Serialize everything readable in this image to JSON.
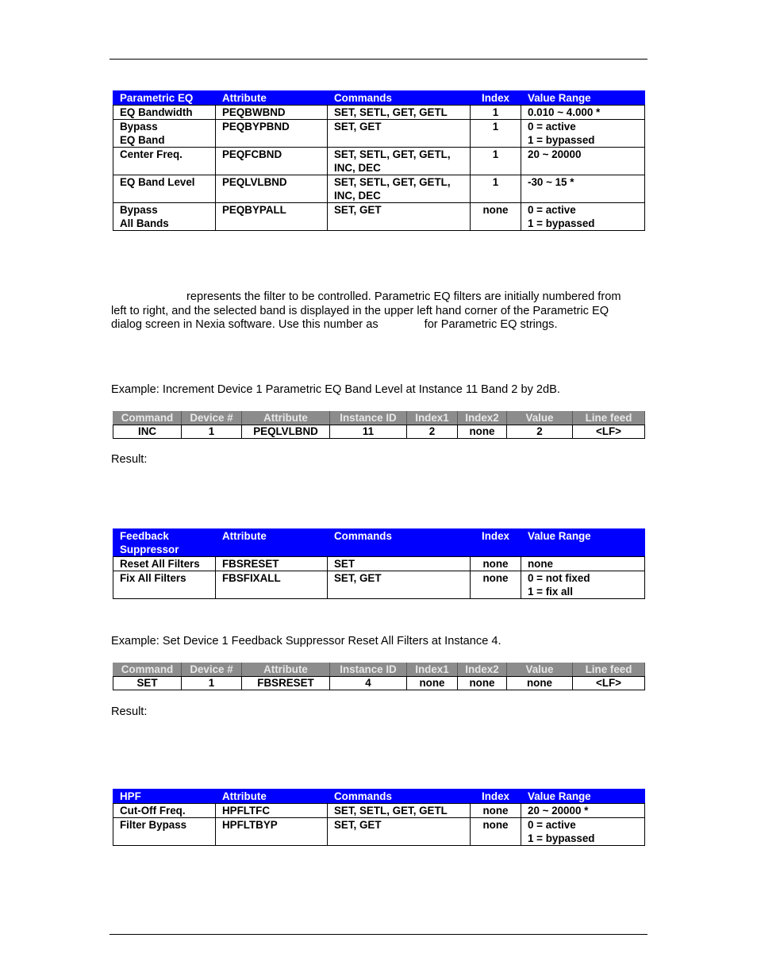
{
  "peq_table": {
    "headers": [
      "Parametric EQ",
      "Attribute",
      "Commands",
      "Index",
      "Value Range"
    ],
    "rows": [
      {
        "name": [
          "EQ Bandwidth"
        ],
        "attribute": "PEQBWBND",
        "commands": [
          "SET, SETL, GET, GETL"
        ],
        "index": "1",
        "range": [
          "0.010 ~ 4.000 *"
        ]
      },
      {
        "name": [
          "Bypass",
          "EQ Band"
        ],
        "attribute": "PEQBYPBND",
        "commands": [
          "SET, GET"
        ],
        "index": "1",
        "range": [
          "0 = active",
          "1 = bypassed"
        ]
      },
      {
        "name": [
          "Center Freq."
        ],
        "attribute": "PEQFCBND",
        "commands": [
          "SET, SETL, GET, GETL,",
          "INC, DEC"
        ],
        "index": "1",
        "range": [
          "20 ~ 20000"
        ]
      },
      {
        "name": [
          "EQ Band Level"
        ],
        "attribute": "PEQLVLBND",
        "commands": [
          "SET, SETL, GET, GETL,",
          "INC, DEC"
        ],
        "index": "1",
        "range": [
          "-30 ~  15 *"
        ]
      },
      {
        "name": [
          "Bypass",
          "All Bands"
        ],
        "attribute": "PEQBYPALL",
        "commands": [
          "SET, GET"
        ],
        "index": "none",
        "range": [
          "0 = active",
          "1 = bypassed"
        ]
      }
    ]
  },
  "peq_paragraph": {
    "part1": "represents the filter to be controlled. Parametric EQ filters are initially numbered from left to right, and the selected band is displayed in the upper left hand corner of the Parametric EQ dialog screen in Nexia software. Use this number as",
    "part2": "for Parametric EQ strings."
  },
  "peq_example": {
    "text": "Example: Increment Device 1 Parametric EQ Band Level at Instance 11 Band 2 by 2dB.",
    "headers": [
      "Command",
      "Device #",
      "Attribute",
      "Instance ID",
      "Index1",
      "Index2",
      "Value",
      "Line feed"
    ],
    "values": [
      "INC",
      "1",
      "PEQLVLBND",
      "11",
      "2",
      "none",
      "2",
      "<LF>"
    ],
    "result_label": "Result:"
  },
  "fbs_table": {
    "headers": [
      "Feedback Suppressor",
      "Attribute",
      "Commands",
      "Index",
      "Value Range"
    ],
    "header_lines": [
      "Feedback",
      "Suppressor"
    ],
    "rows": [
      {
        "name": [
          "Reset All Filters"
        ],
        "attribute": "FBSRESET",
        "commands": [
          "SET"
        ],
        "index": "none",
        "range": [
          "none"
        ]
      },
      {
        "name": [
          "Fix All Filters"
        ],
        "attribute": "FBSFIXALL",
        "commands": [
          "SET, GET"
        ],
        "index": "none",
        "range": [
          "0 = not fixed",
          "1 = fix all"
        ]
      }
    ]
  },
  "fbs_example": {
    "text": "Example: Set Device 1 Feedback Suppressor Reset All Filters at Instance 4.",
    "headers": [
      "Command",
      "Device #",
      "Attribute",
      "Instance ID",
      "Index1",
      "Index2",
      "Value",
      "Line feed"
    ],
    "values": [
      "SET",
      "1",
      "FBSRESET",
      "4",
      "none",
      "none",
      "none",
      "<LF>"
    ],
    "result_label": "Result:"
  },
  "hpf_table": {
    "headers": [
      "HPF",
      "Attribute",
      "Commands",
      "Index",
      "Value Range"
    ],
    "rows": [
      {
        "name": [
          "Cut-Off Freq."
        ],
        "attribute": "HPFLTFC",
        "commands": [
          "SET, SETL, GET, GETL"
        ],
        "index": "none",
        "range": [
          "20 ~ 20000 *"
        ]
      },
      {
        "name": [
          "Filter Bypass"
        ],
        "attribute": "HPFLTBYP",
        "commands": [
          "SET, GET"
        ],
        "index": "none",
        "range": [
          "0 = active",
          "1 = bypassed"
        ]
      }
    ]
  }
}
